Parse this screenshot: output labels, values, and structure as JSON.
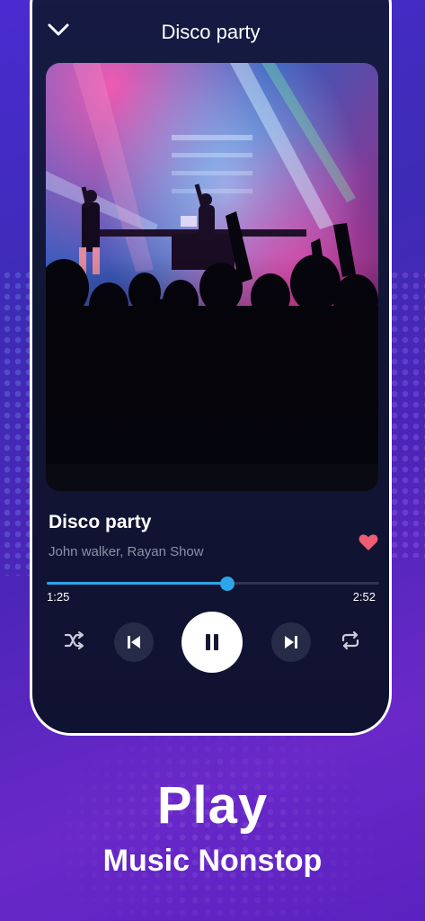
{
  "app": {
    "now_playing_title": "Disco party"
  },
  "track": {
    "title": "Disco party",
    "artist": "John walker, Rayan Show",
    "liked": true,
    "elapsed": "1:25",
    "total": "2:52",
    "progress_fraction": 0.544
  },
  "controls": {
    "shuffle_icon": "shuffle-icon",
    "previous_icon": "skip-previous-icon",
    "play_state_icon": "pause-icon",
    "next_icon": "skip-next-icon",
    "repeat_icon": "repeat-icon"
  },
  "promo": {
    "headline": "Play",
    "subheadline": "Music Nonstop"
  },
  "colors": {
    "accent": "#2ea5e8",
    "heart": "#ef5d74",
    "frame": "#ffffff"
  }
}
